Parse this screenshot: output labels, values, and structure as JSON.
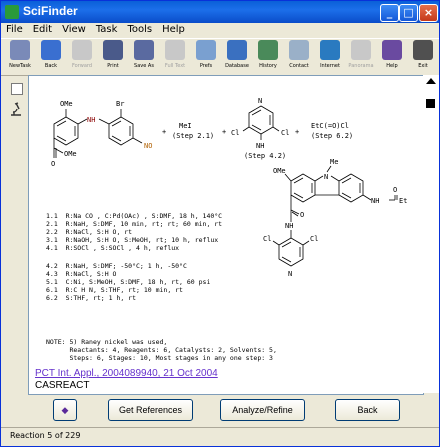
{
  "window": {
    "title": "SciFinder"
  },
  "menu": [
    "File",
    "Edit",
    "View",
    "Task",
    "Tools",
    "Help"
  ],
  "toolbar": [
    {
      "label": "NewTask",
      "icon": "new-task-icon",
      "enabled": true,
      "color": "#7a8ab8"
    },
    {
      "label": "Back",
      "icon": "back-arrow-icon",
      "enabled": true,
      "color": "#3a6fd0"
    },
    {
      "label": "Forward",
      "icon": "forward-arrow-icon",
      "enabled": false,
      "color": "#c8c8c8"
    },
    {
      "label": "Print",
      "icon": "printer-icon",
      "enabled": true,
      "color": "#4a5a8a"
    },
    {
      "label": "Save As",
      "icon": "save-icon",
      "enabled": true,
      "color": "#5a6aa0"
    },
    {
      "label": "Full Text",
      "icon": "full-text-icon",
      "enabled": false,
      "color": "#c8c8c8"
    },
    {
      "label": "Prefs",
      "icon": "preferences-icon",
      "enabled": true,
      "color": "#7aa0d0"
    },
    {
      "label": "Database",
      "icon": "database-icon",
      "enabled": true,
      "color": "#3a70c0"
    },
    {
      "label": "History",
      "icon": "history-icon",
      "enabled": true,
      "color": "#4a8a5a"
    },
    {
      "label": "Contact",
      "icon": "contact-icon",
      "enabled": true,
      "color": "#9ab0c8"
    },
    {
      "label": "Internet",
      "icon": "globe-icon",
      "enabled": true,
      "color": "#2a7ac0"
    },
    {
      "label": "Panorama",
      "icon": "panorama-icon",
      "enabled": false,
      "color": "#c8c8c8"
    },
    {
      "label": "Help",
      "icon": "help-icon",
      "enabled": true,
      "color": "#6a4aa0"
    },
    {
      "label": "Exit",
      "icon": "exit-icon",
      "enabled": true,
      "color": "#505050"
    }
  ],
  "reaction": {
    "reagents": {
      "r1_ome": "OMe",
      "r1_br": "Br",
      "r1_nh": "NH",
      "r1_no": "NO",
      "r1_ester": "OMe",
      "r1_o": "O",
      "plus1": "+",
      "mei": "MeI",
      "step21": "(Step 2.1)",
      "plus2": "+",
      "r3_n": "N",
      "r3_cl1": "Cl",
      "r3_cl2": "Cl",
      "r3_nh": "NH",
      "r3_step": "(Step 4.2)",
      "plus3": "+",
      "etcocl": "EtC(=O)Cl",
      "step62": "(Step 6.2)"
    },
    "steps": [
      "1.1  R:Na CO , C:Pd(OAc) , S:DMF, 18 h, 140°C",
      "2.1  R:NaH, S:DMF, 10 min, rt; rt; 60 min, rt",
      "2.2  R:NaCl, S:H O, rt",
      "3.1  R:NaOH, S:H O, S:MeOH, rt; 10 h, reflux",
      "4.1  R:SOCl , S:SOCl , 4 h, reflux",
      "4.2  R:NaH, S:DMF; -50°C; 1 h, -50°C",
      "4.3  R:NaCl, S:H O",
      "5.1  C:Ni, S:MeOH, S:DMF, 18 h, rt, 60 psi",
      "6.1  R:C H N, S:THF, rt; 10 min, rt",
      "6.2  S:THF, rt; 1 h, rt"
    ],
    "product": {
      "ome": "OMe",
      "n": "N",
      "me": "Me",
      "o": "O",
      "nh": "NH",
      "amide": "C",
      "et": "Et",
      "nh2": "NH",
      "n2": "N",
      "cl1": "Cl",
      "cl2": "Cl"
    },
    "notes": [
      "NOTE: 5) Raney nickel was used,",
      "      Reactants: 4, Reagents: 6, Catalysts: 2, Solvents: 5,",
      "      Steps: 6, Stages: 10, Most stages in any one step: 3"
    ],
    "reference": "PCT Int. Appl., 2004089940, 21 Oct 2004",
    "database": "CASREACT"
  },
  "buttons": {
    "help_icon": "◆",
    "get_references": "Get References",
    "analyze_refine": "Analyze/Refine",
    "back": "Back"
  },
  "status": "Reaction 5 of 229"
}
